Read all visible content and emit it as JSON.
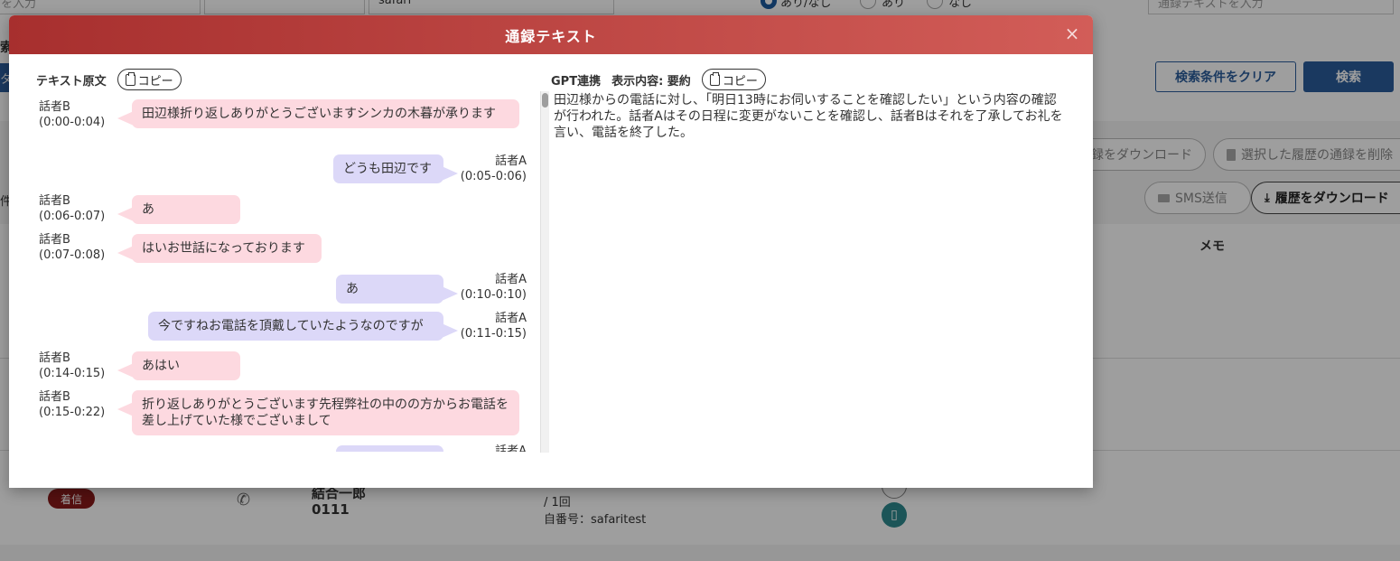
{
  "background": {
    "search_input_left_value": "を入力",
    "search_input_mid_value": "safari",
    "radio_labels": [
      "あり/なし",
      "あり",
      "なし"
    ],
    "call_text_input_placeholder": "通録テキストを入力",
    "side_label_top": "索",
    "side_tab_label": "タ",
    "side_label_mid": "件",
    "clear_button_label": "検索条件をクリア",
    "search_button_label": "検索",
    "download_recording_label": "録をダウンロード",
    "delete_selected_label": "選択した履歴の通録を削除",
    "sms_button_label": "SMS送信",
    "history_download_label": "履歴をダウンロード",
    "memo_column_header": "メモ",
    "row": {
      "status_badge": "着信",
      "name": "結合一郎",
      "number": "0111",
      "count_text": "/ 1回",
      "self_number_text": "自番号：safaritest"
    }
  },
  "modal": {
    "title": "通録テキスト",
    "close_label": "×",
    "left": {
      "heading": "テキスト原文",
      "copy_label": "コピー",
      "messages": [
        {
          "side": "b",
          "speaker": "話者B",
          "time": "(0:00-0:04)",
          "text": "田辺様折り返しありがとうございますシンカの木暮が承ります"
        },
        {
          "side": "a",
          "speaker": "話者A",
          "time": "(0:05-0:06)",
          "text": "どうも田辺です"
        },
        {
          "side": "b",
          "speaker": "話者B",
          "time": "(0:06-0:07)",
          "text": "あ"
        },
        {
          "side": "b",
          "speaker": "話者B",
          "time": "(0:07-0:08)",
          "text": "はいお世話になっております"
        },
        {
          "side": "a",
          "speaker": "話者A",
          "time": "(0:10-0:10)",
          "text": "あ"
        },
        {
          "side": "a",
          "speaker": "話者A",
          "time": "(0:11-0:15)",
          "text": "今ですねお電話を頂戴していたようなのですが"
        },
        {
          "side": "b",
          "speaker": "話者B",
          "time": "(0:14-0:15)",
          "text": "あはい"
        },
        {
          "side": "b",
          "speaker": "話者B",
          "time": "(0:15-0:22)",
          "text": "折り返しありがとうございます先程弊社の中のの方からお電話を差し上げていた様でございまして"
        },
        {
          "side": "a",
          "speaker": "話者A",
          "time": "",
          "text": ""
        }
      ]
    },
    "right": {
      "heading": "GPT連携",
      "display_label": "表示内容: 要約",
      "copy_label": "コピー",
      "summary": "田辺様からの電話に対し、「明日13時にお伺いすることを確認したい」という内容の確認が行われた。話者Aはその日程に変更がないことを確認し、話者Bはそれを了承してお礼を言い、電話を終了した。"
    }
  }
}
